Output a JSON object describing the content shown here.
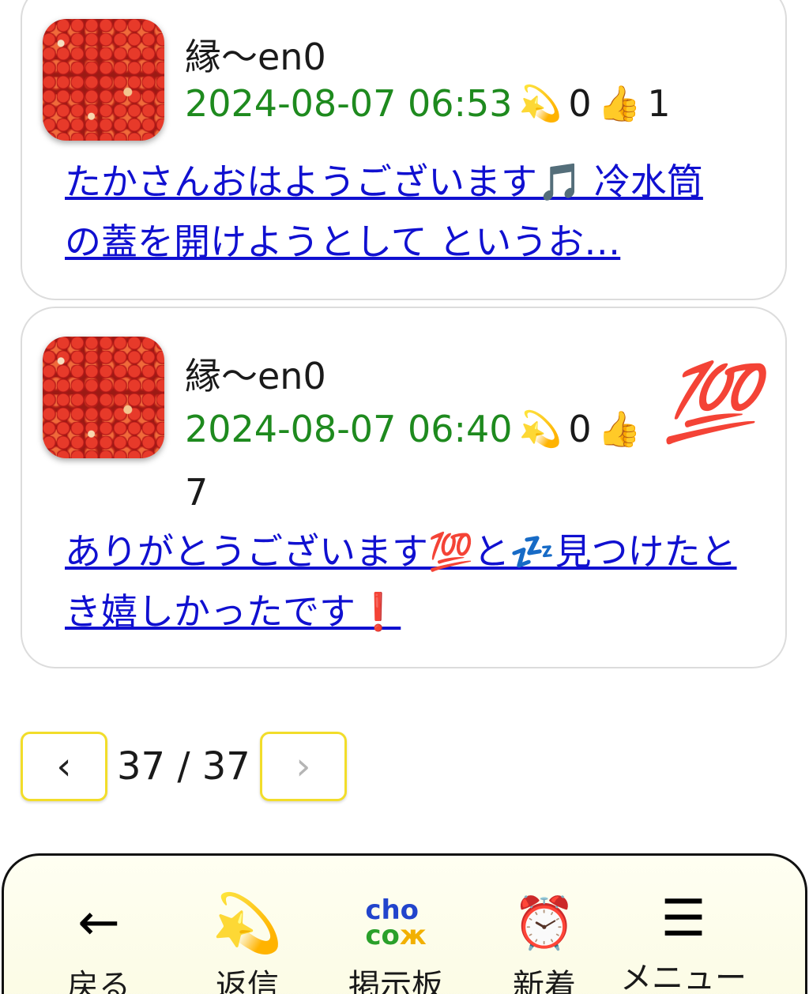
{
  "posts": [
    {
      "username": "縁〜en0",
      "datetime": "2024-08-07 06:53",
      "reply_emoji": "💫",
      "reply_count": "0",
      "like_emoji": "👍",
      "like_count": "1",
      "message": "たかさんおはようございます🎵 冷水筒の蓋を開けようとして というお…"
    },
    {
      "username": "縁〜en0",
      "datetime": "2024-08-07 06:40",
      "reply_emoji": "💫",
      "reply_count": "0",
      "like_emoji": "👍",
      "like_count": "7",
      "sticker": "💯",
      "message": "ありがとうございます💯と💤見つけたとき嬉しかったです❗"
    }
  ],
  "pager": {
    "prev_label": "‹",
    "next_label": "›",
    "page_text": "37 / 37"
  },
  "nav": {
    "back": {
      "icon": "←",
      "label": "戻る"
    },
    "reply": {
      "icon": "💫",
      "label": "返信"
    },
    "board": {
      "logo_line1": "cho",
      "logo_line2": "co",
      "logo_suffix": "ж",
      "label": "掲示板"
    },
    "new": {
      "icon": "⏰",
      "label": "新着"
    },
    "menu": {
      "icon": "☰",
      "label": "メニュー"
    }
  }
}
